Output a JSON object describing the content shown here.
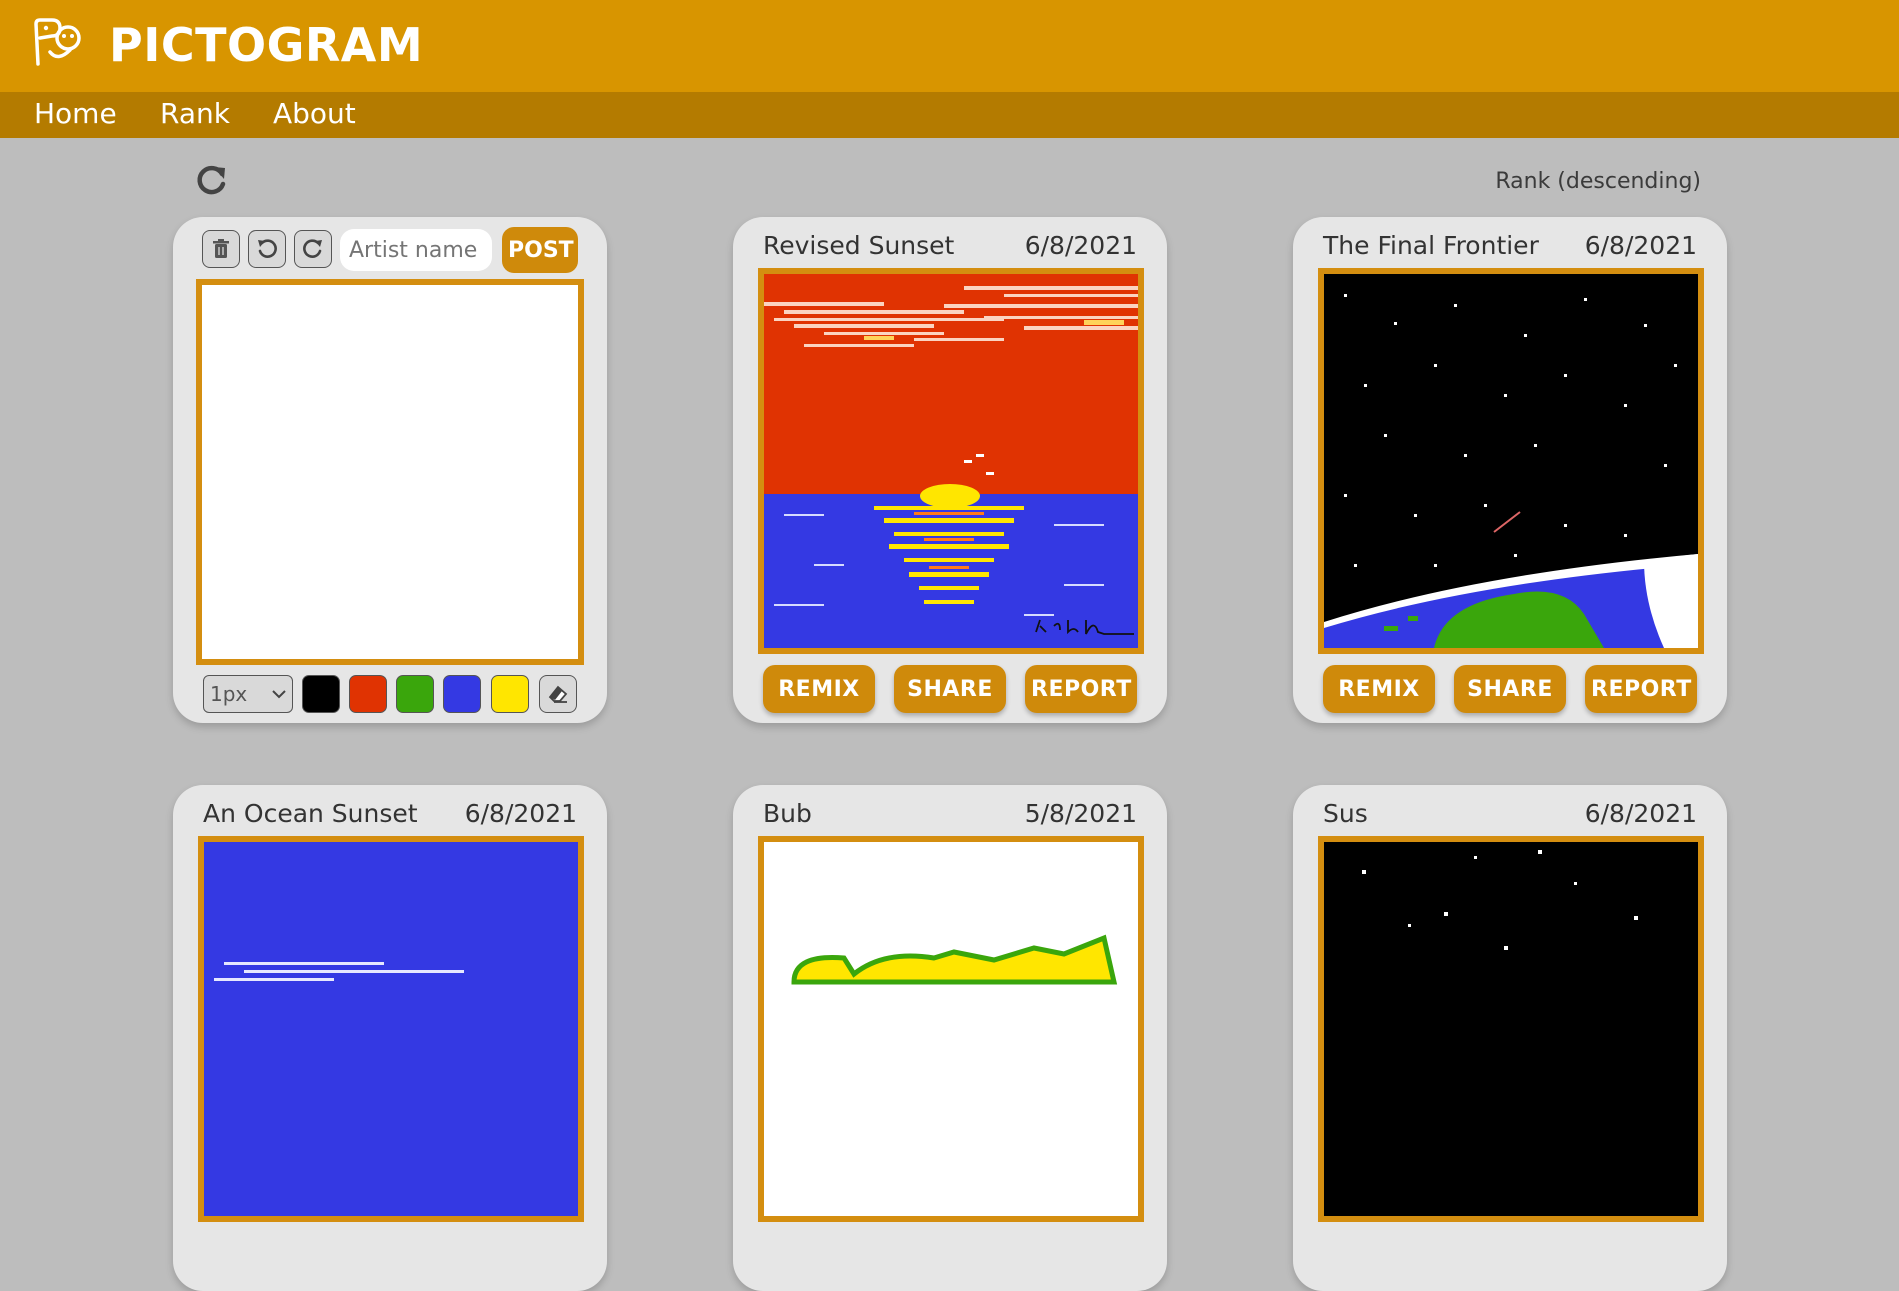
{
  "app": {
    "title": "PICTOGRAM",
    "logo_icon": "face-icon"
  },
  "nav": {
    "items": [
      "Home",
      "Rank",
      "About"
    ]
  },
  "sort": {
    "label": "Rank (descending)"
  },
  "composer": {
    "artist_placeholder": "Artist name",
    "post_label": "POST",
    "brush_size": "1px",
    "colors": [
      "#000000",
      "#e03302",
      "#3aa60c",
      "#3439e3",
      "#ffe600"
    ]
  },
  "actions": {
    "remix": "REMIX",
    "share": "SHARE",
    "report": "REPORT"
  },
  "posts": [
    {
      "title": "Revised Sunset",
      "date": "6/8/2021"
    },
    {
      "title": "The Final Frontier",
      "date": "6/8/2021"
    },
    {
      "title": "An Ocean Sunset",
      "date": "6/8/2021"
    },
    {
      "title": "Bub",
      "date": "5/8/2021"
    },
    {
      "title": "Sus",
      "date": "6/8/2021"
    }
  ],
  "colors": {
    "header": "#d89500",
    "nav": "#b47b00",
    "accent": "#cf8a0b",
    "background": "#bdbdbd"
  }
}
